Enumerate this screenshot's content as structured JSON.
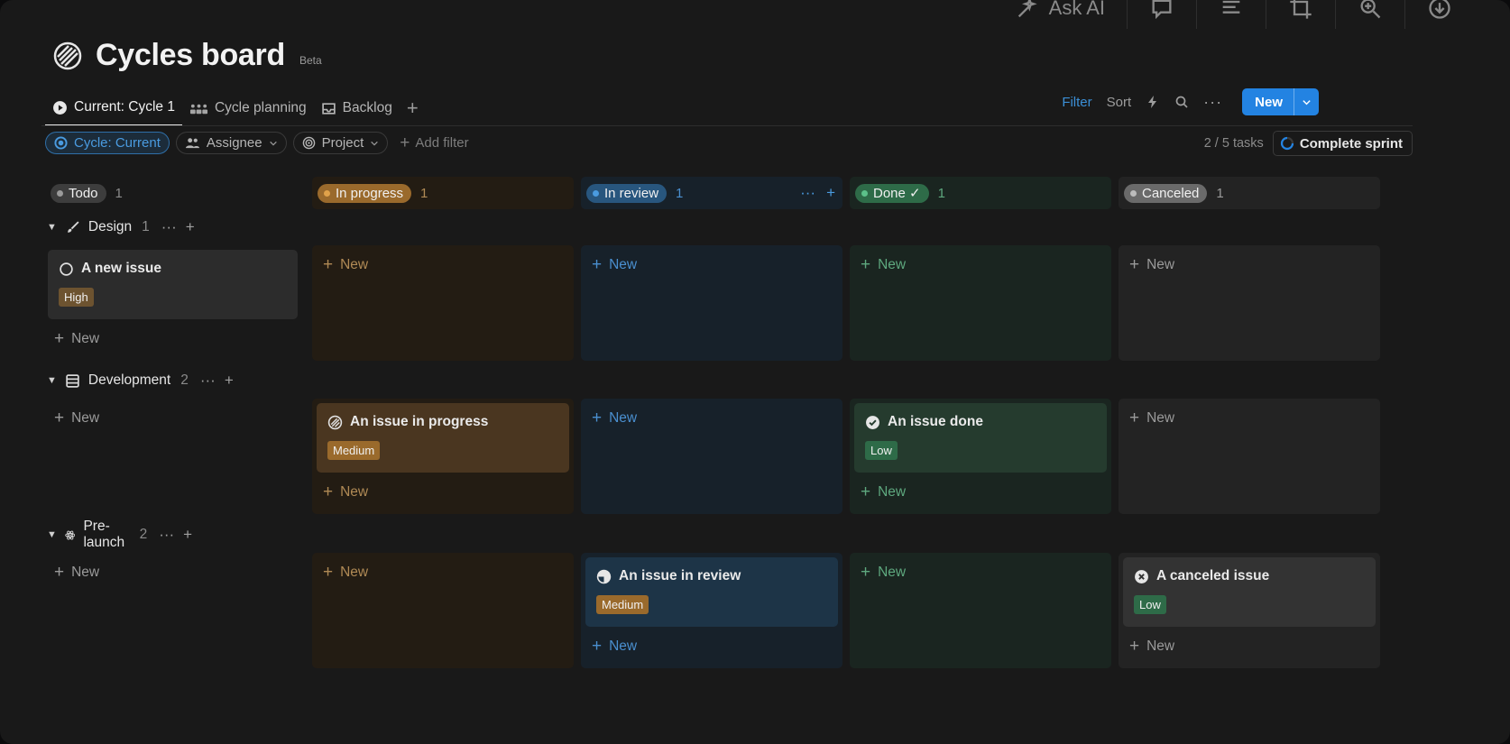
{
  "topbar": {
    "ask_ai": "Ask AI"
  },
  "page": {
    "title": "Cycles board",
    "badge": "Beta"
  },
  "tabs": [
    {
      "label": "Current: Cycle 1",
      "active": true,
      "icon": "play-circle-icon"
    },
    {
      "label": "Cycle planning",
      "icon": "people-icon"
    },
    {
      "label": "Backlog",
      "icon": "inbox-icon"
    }
  ],
  "actions": {
    "filter": "Filter",
    "sort": "Sort",
    "new": "New"
  },
  "filters": {
    "cycle": "Cycle: Current",
    "assignee": "Assignee",
    "project": "Project",
    "add_filter": "Add filter"
  },
  "sprint": {
    "tasks": "2 / 5 tasks",
    "complete": "Complete sprint"
  },
  "columns": [
    {
      "label": "Todo",
      "count": "1"
    },
    {
      "label": "In progress",
      "count": "1"
    },
    {
      "label": "In review",
      "count": "1"
    },
    {
      "label": "Done ✓",
      "count": "1"
    },
    {
      "label": "Canceled",
      "count": "1"
    }
  ],
  "groups": [
    {
      "label": "Design",
      "count": "1",
      "icon": "brush-icon"
    },
    {
      "label": "Development",
      "count": "2",
      "icon": "server-icon"
    },
    {
      "label": "Pre-launch",
      "count": "2",
      "icon": "atom-icon"
    }
  ],
  "cards": {
    "design_todo": {
      "title": "A new issue",
      "priority": "High"
    },
    "dev_progress": {
      "title": "An issue in progress",
      "priority": "Medium"
    },
    "dev_done": {
      "title": "An issue done",
      "priority": "Low"
    },
    "pre_review": {
      "title": "An issue in review",
      "priority": "Medium"
    },
    "pre_canceled": {
      "title": "A canceled issue",
      "priority": "Low"
    }
  },
  "new_label": "New",
  "colors": {
    "accent": "#2383e2",
    "todo": "#7a7a7a",
    "progress": "#9a6a2c",
    "review": "#28567e",
    "done": "#2e6b48",
    "canceled": "#6a6a6a"
  }
}
